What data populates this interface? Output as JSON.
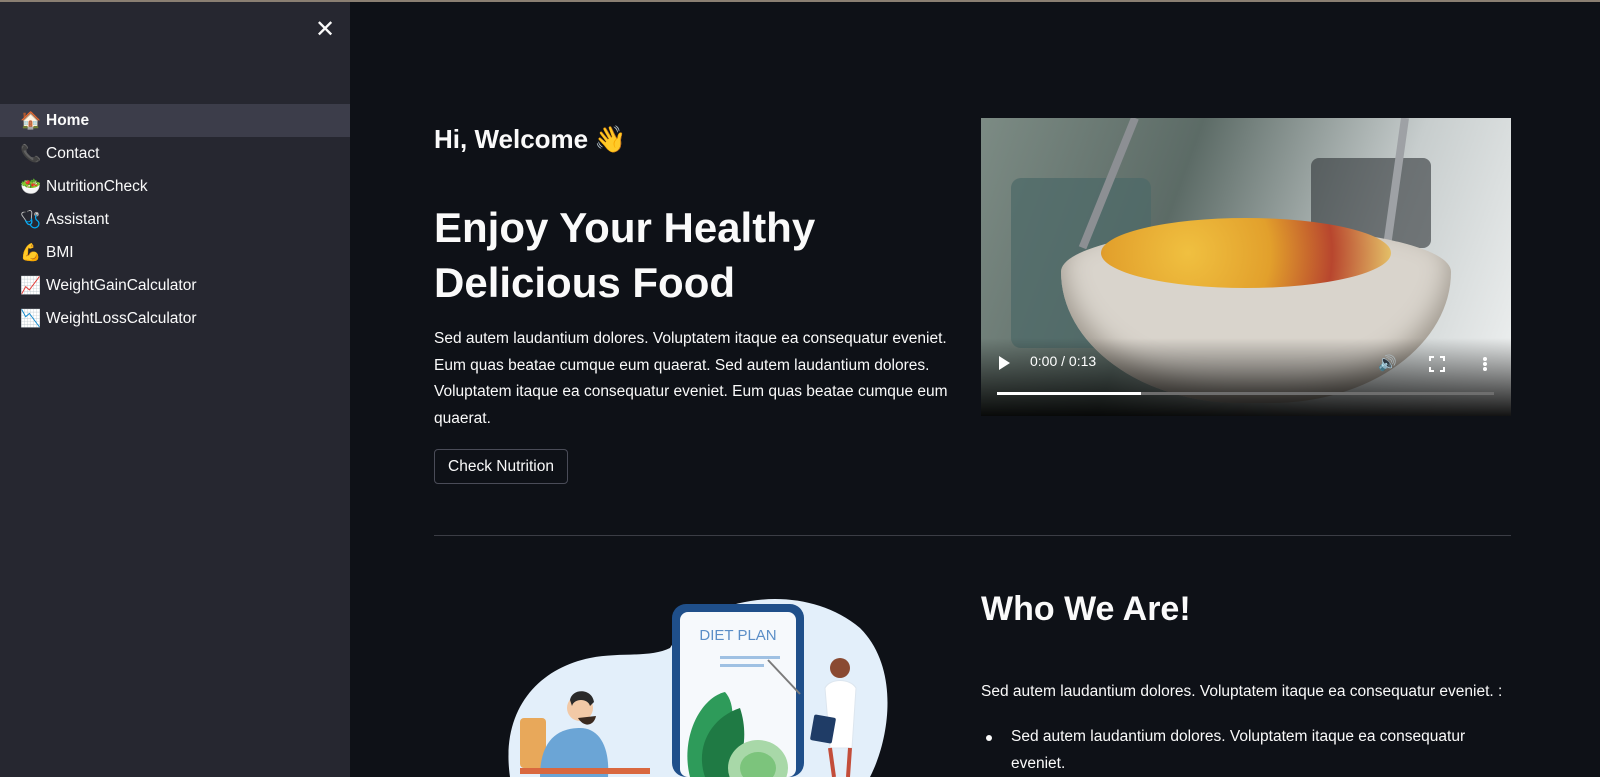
{
  "sidebar": {
    "close_icon": "close-icon",
    "items": [
      {
        "label": "Home",
        "icon": "house-icon",
        "glyph": "🏠",
        "active": true
      },
      {
        "label": "Contact",
        "icon": "phone-icon",
        "glyph": "📞",
        "active": false
      },
      {
        "label": "NutritionCheck",
        "icon": "nutrition-icon",
        "glyph": "🥗",
        "active": false
      },
      {
        "label": "Assistant",
        "icon": "stethoscope-icon",
        "glyph": "🩺",
        "active": false
      },
      {
        "label": "BMI",
        "icon": "flexed-biceps-icon",
        "glyph": "💪",
        "active": false
      },
      {
        "label": "WeightGainCalculator",
        "icon": "chart-increasing-icon",
        "glyph": "📈",
        "active": false
      },
      {
        "label": "WeightLossCalculator",
        "icon": "chart-decreasing-icon",
        "glyph": "📉",
        "active": false
      }
    ]
  },
  "hero": {
    "greeting": "Hi, Welcome",
    "greeting_icon": "waving-hand-icon",
    "headline": "Enjoy Your Healthy Delicious Food",
    "paragraph": "Sed autem laudantium dolores. Voluptatem itaque ea consequatur eveniet. Eum quas beatae cumque eum quaerat. Sed autem laudantium dolores. Voluptatem itaque ea consequatur eveniet. Eum quas beatae cumque eum quaerat.",
    "button_label": "Check Nutrition"
  },
  "video": {
    "time": "0:00 / 0:13",
    "progress": 0.29
  },
  "illustration": {
    "label": "DIET PLAN"
  },
  "about": {
    "title": "Who We Are!",
    "intro": "Sed autem laudantium dolores. Voluptatem itaque ea consequatur eveniet. :",
    "bullets": [
      "Sed autem laudantium dolores. Voluptatem itaque ea consequatur eveniet."
    ]
  },
  "colors": {
    "background": "#0e1117",
    "sidebar": "#262730",
    "active_item": "#3c3d4a",
    "text": "#fafafa"
  }
}
